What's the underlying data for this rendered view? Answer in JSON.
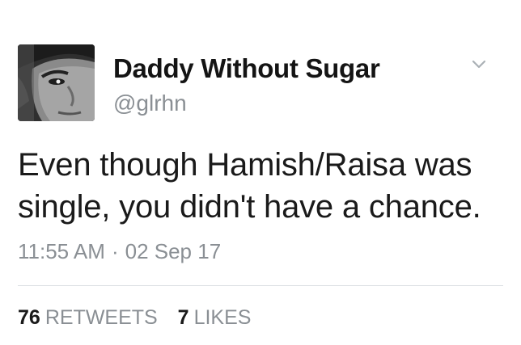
{
  "user": {
    "display_name": "Daddy Without Sugar",
    "handle": "@glrhn",
    "avatar_icon": "profile-photo"
  },
  "menu": {
    "icon": "chevron-down-icon"
  },
  "tweet": {
    "lines": [
      "Even though Hamish/Raisa was",
      "single, you didn't have a chance."
    ],
    "time": "11:55 AM",
    "separator": "·",
    "date": "02 Sep 17"
  },
  "stats": {
    "retweets": {
      "count": "76",
      "label": "RETWEETS"
    },
    "likes": {
      "count": "7",
      "label": "LIKES"
    }
  },
  "colors": {
    "text": "#1a1a1a",
    "secondary": "#8a8f94",
    "divider": "#dde1e4"
  }
}
